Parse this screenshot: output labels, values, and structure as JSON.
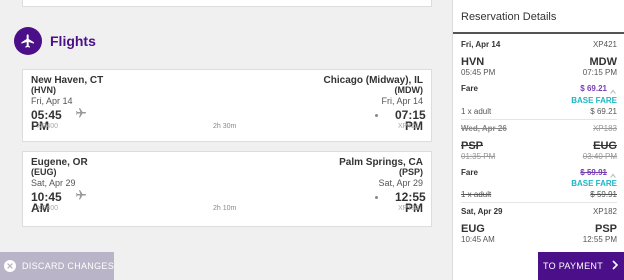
{
  "section": {
    "title": "Flights",
    "icon": "airplane-icon"
  },
  "flights": [
    {
      "origin_city": "New Haven, CT",
      "origin_code": "(HVN)",
      "origin_date": "Fri, Apr 14",
      "dest_city": "Chicago (Midway), IL",
      "dest_code": "(MDW)",
      "dest_date": "Fri, Apr 14",
      "dep_time": "05:45 PM",
      "arr_time": "07:15 PM",
      "duration": "2h 30m",
      "flight_num_left": "XP400",
      "flight_num_right": "XP421"
    },
    {
      "origin_city": "Eugene, OR",
      "origin_code": "(EUG)",
      "origin_date": "Sat, Apr 29",
      "dest_city": "Palm Springs, CA",
      "dest_code": "(PSP)",
      "dest_date": "Sat, Apr 29",
      "dep_time": "10:45 AM",
      "arr_time": "12:55 PM",
      "duration": "2h 10m",
      "flight_num_left": "XP400",
      "flight_num_right": "XP182"
    }
  ],
  "footer": {
    "discard_label": "DISCARD CHANGES",
    "payment_label": "TO PAYMENT"
  },
  "sidebar": {
    "title": "Reservation Details",
    "segments": [
      {
        "date": "Fri, Apr 14",
        "flight_no": "XP421",
        "origin": "HVN",
        "origin_time": "05:45 PM",
        "dest": "MDW",
        "dest_time": "07:15 PM",
        "fare_label": "Fare",
        "fare_price": "$ 69.21",
        "base_fare_label": "BASE FARE",
        "adult_label": "1 x adult",
        "adult_price": "$ 69.21"
      },
      {
        "date": "Wed, Apr 26",
        "flight_no": "XP183",
        "origin": "PSP",
        "origin_time": "01:35 PM",
        "dest": "EUG",
        "dest_time": "03:40 PM",
        "fare_label": "Fare",
        "fare_price": "$ 59.91",
        "base_fare_label": "BASE FARE",
        "adult_label": "1 x adult",
        "adult_price": "$ 59.91"
      },
      {
        "date": "Sat, Apr 29",
        "flight_no": "XP182",
        "origin": "EUG",
        "origin_time": "10:45 AM",
        "dest": "PSP",
        "dest_time": "12:55 PM"
      }
    ]
  },
  "colors": {
    "brand": "#4b0f8a",
    "accent_teal": "#1cb6c4",
    "price_purple": "#7a3db3",
    "discard_bg": "#b9b4c8"
  }
}
